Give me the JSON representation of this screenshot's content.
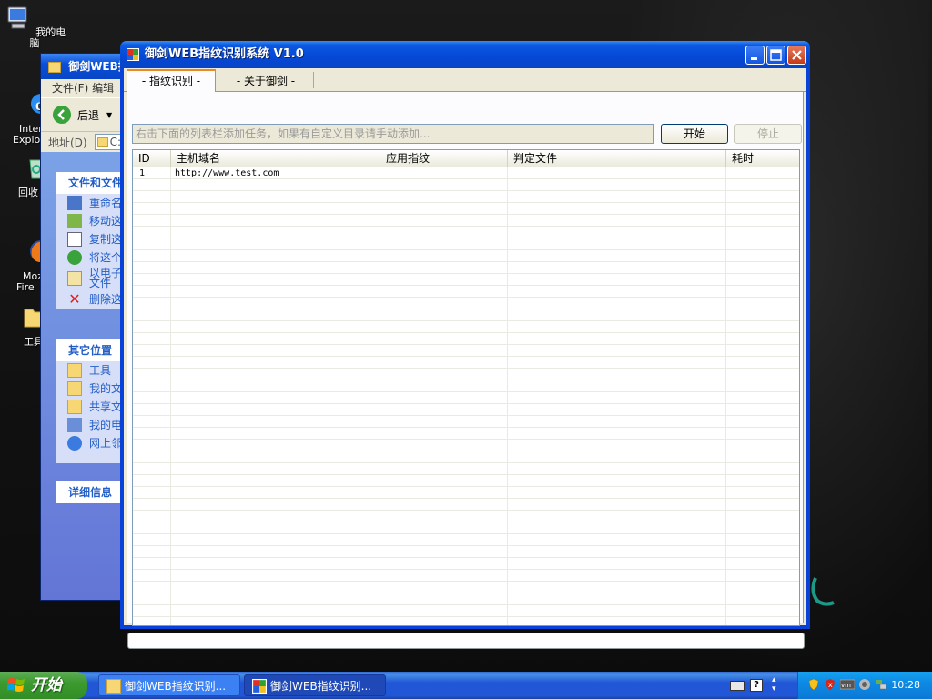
{
  "desktop": {
    "icons": [
      {
        "label": "我的电脑"
      },
      {
        "label": "Inter\nExplo"
      },
      {
        "label": "回收"
      },
      {
        "label": "Mozil\nFire"
      },
      {
        "label": "工具"
      }
    ]
  },
  "explorer": {
    "title": "御剑WEB指",
    "menu": "文件(F)  编辑",
    "back_label": "后退",
    "address_label": "地址(D)",
    "address_value": "C:",
    "file_tasks": {
      "header": "文件和文件",
      "items": [
        "重命名",
        "移动这",
        "复制这",
        "将这个",
        "以电子\n文件",
        "删除这"
      ]
    },
    "other_places": {
      "header": "其它位置",
      "items": [
        "工具",
        "我的文",
        "共享文",
        "我的电",
        "网上邻"
      ]
    },
    "details": {
      "header": "详细信息"
    }
  },
  "window": {
    "title": "御剑WEB指纹识别系统  V1.0",
    "tabs": [
      {
        "label": "- 指纹识别 -",
        "active": true
      },
      {
        "label": "- 关于御剑 -",
        "active": false
      }
    ],
    "task_input_placeholder": "右击下面的列表栏添加任务，如果有自定义目录请手动添加...",
    "start_button": "开始",
    "stop_button": "停止",
    "table": {
      "columns": [
        "ID",
        "主机域名",
        "应用指纹",
        "判定文件",
        "耗时"
      ],
      "rows": [
        {
          "id": "1",
          "host": "http://www.test.com",
          "app": "",
          "file": "",
          "time": ""
        }
      ]
    }
  },
  "taskbar": {
    "start_label": "开始",
    "tasks": [
      {
        "label": "御剑WEB指纹识别..."
      },
      {
        "label": "御剑WEB指纹识别..."
      }
    ],
    "clock": "10:28"
  }
}
